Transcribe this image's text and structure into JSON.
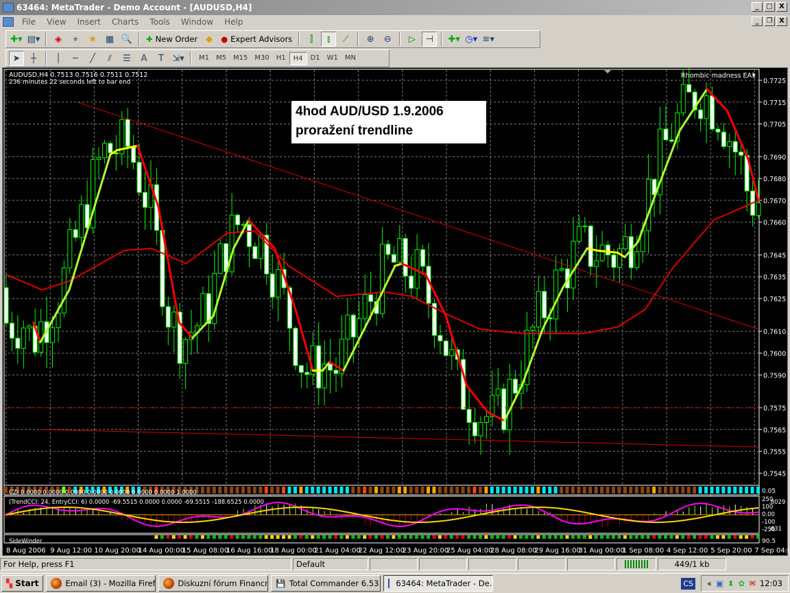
{
  "window": {
    "title": "63464: MetaTrader - Demo Account - [AUDUSD,H4]",
    "min": "_",
    "max": "□",
    "close": "X",
    "restore": "❐"
  },
  "menu": [
    "File",
    "View",
    "Insert",
    "Charts",
    "Tools",
    "Window",
    "Help"
  ],
  "toolbar": {
    "new_order": "New Order",
    "expert_advisors": "Expert Advisors"
  },
  "drawing_tools": {
    "text_tool": "A",
    "label_tool": "T"
  },
  "timeframes": [
    "M1",
    "M5",
    "M15",
    "M30",
    "H1",
    "H4",
    "D1",
    "W1",
    "MN"
  ],
  "active_timeframe": "H4",
  "chart": {
    "info": "AUDUSD,H4  0.7513 0.7516 0.7511 0.7512",
    "timer": "236 minutes 22 seconds left to bar end",
    "expert": "Rhombic madness EA1",
    "expert_icon": "smiley-star-icon",
    "annotation": [
      "4hod AUD/USD 1.9.2006",
      "proražení trendline"
    ],
    "price_ticks": [
      "0.7725",
      "0.7715",
      "0.7705",
      "0.7690",
      "0.7680",
      "0.7670",
      "0.7660",
      "0.7645",
      "0.7635",
      "0.7625",
      "0.7610",
      "0.7600",
      "0.7590",
      "0.7575",
      "0.7565",
      "0.7555",
      "0.7545"
    ],
    "time_ticks": [
      "8 Aug 2006",
      "9 Aug 12:00",
      "10 Aug 20:00",
      "14 Aug 00:00",
      "15 Aug 08:00",
      "16 Aug 16:00",
      "18 Aug 00:00",
      "21 Aug 04:00",
      "22 Aug 12:00",
      "23 Aug 20:00",
      "25 Aug 04:00",
      "28 Aug 08:00",
      "29 Aug 16:00",
      "31 Aug 00:00",
      "1 Sep 08:00",
      "4 Sep 12:00",
      "5 Sep 20:00",
      "7 Sep 04:00"
    ],
    "bars": 131,
    "fast_line": [
      [
        4.7,
        0.7614
      ],
      [
        5.9,
        0.7605
      ],
      [
        10.9,
        0.7629
      ],
      [
        18,
        0.7691
      ],
      [
        19.2,
        0.7693
      ],
      [
        22.7,
        0.7695
      ],
      [
        26.3,
        0.7667
      ],
      [
        29.9,
        0.7614
      ],
      [
        32.2,
        0.7607
      ],
      [
        35.8,
        0.7617
      ],
      [
        39.3,
        0.7648
      ],
      [
        41.9,
        0.7661
      ],
      [
        46.4,
        0.7648
      ],
      [
        50,
        0.762
      ],
      [
        53,
        0.7592
      ],
      [
        54.7,
        0.7592
      ],
      [
        55.9,
        0.7596
      ],
      [
        58.3,
        0.7592
      ],
      [
        63,
        0.7617
      ],
      [
        67.2,
        0.764
      ],
      [
        68.4,
        0.7641
      ],
      [
        72.5,
        0.7636
      ],
      [
        76,
        0.7617
      ],
      [
        79.6,
        0.7585
      ],
      [
        83.2,
        0.7573
      ],
      [
        86.1,
        0.7569
      ],
      [
        89.1,
        0.7585
      ],
      [
        92.7,
        0.7611
      ],
      [
        96.2,
        0.763
      ],
      [
        100.4,
        0.7648
      ],
      [
        102.1,
        0.7647
      ],
      [
        105.7,
        0.7646
      ],
      [
        106.9,
        0.7644
      ],
      [
        109.2,
        0.7651
      ],
      [
        112.8,
        0.7677
      ],
      [
        116.4,
        0.7702
      ],
      [
        121.1,
        0.7721
      ],
      [
        124.6,
        0.7711
      ],
      [
        128.2,
        0.7689
      ],
      [
        130,
        0.767
      ]
    ],
    "slow_ma": [
      [
        0,
        0.7636
      ],
      [
        6.2,
        0.7629
      ],
      [
        10.9,
        0.7633
      ],
      [
        20.4,
        0.7647
      ],
      [
        25.1,
        0.7648
      ],
      [
        31.1,
        0.7641
      ],
      [
        38.2,
        0.7655
      ],
      [
        42.9,
        0.7656
      ],
      [
        48.8,
        0.764
      ],
      [
        57.1,
        0.7626
      ],
      [
        65.4,
        0.7628
      ],
      [
        70.1,
        0.7626
      ],
      [
        76,
        0.7618
      ],
      [
        81.9,
        0.7611
      ],
      [
        89.1,
        0.7609
      ],
      [
        99.8,
        0.7609
      ],
      [
        105.7,
        0.7612
      ],
      [
        110.4,
        0.762
      ],
      [
        115.2,
        0.7639
      ],
      [
        122.3,
        0.7661
      ],
      [
        130,
        0.767
      ]
    ],
    "trendline_upper": [
      [
        12.3,
        0.7715
      ],
      [
        130,
        0.7611
      ]
    ],
    "trendline_lower": [
      [
        5.9,
        0.7565
      ],
      [
        130,
        0.7557
      ]
    ],
    "level_dashed": 0.7575,
    "colors": {
      "bull": "#00ff00",
      "fast_up": "#adff2f",
      "fast_down": "#ff0000",
      "extreme": "#ffff00",
      "ma": "#e00000",
      "grid": "#808080"
    }
  },
  "indicators": {
    "czi_label": "CZI 0.0000 0.0000 0.0000 0.0000 0.0000 0.0000 0.0000 1.0000",
    "czi_axis": "0.05",
    "cci_label": "(TrendCCI: 24, EntryCCI: 6) 0.0000 -69.5515 0.0000 0.0000 -69.5515 -188.6525 0.0000",
    "cci_axis": [
      "250",
      "100",
      "0.00",
      "-100",
      "-250"
    ],
    "cci_side": [
      ".8029",
      ".631"
    ],
    "sidewinder_label": "SideWinder",
    "sidewinder_axis": "90.5"
  },
  "status": {
    "help": "For Help, press F1",
    "profile": "Default",
    "traffic": "449/1 kb"
  },
  "taskbar": {
    "start": "Start",
    "tasks": [
      "Email (3) - Mozilla Firefox",
      "Diskuzní fórum Financnik....",
      "Total Commander 6.53 - ...",
      "63464: MetaTrader - De..."
    ],
    "lang": "CS",
    "clock": "12:03",
    "tray_expand": "«"
  }
}
